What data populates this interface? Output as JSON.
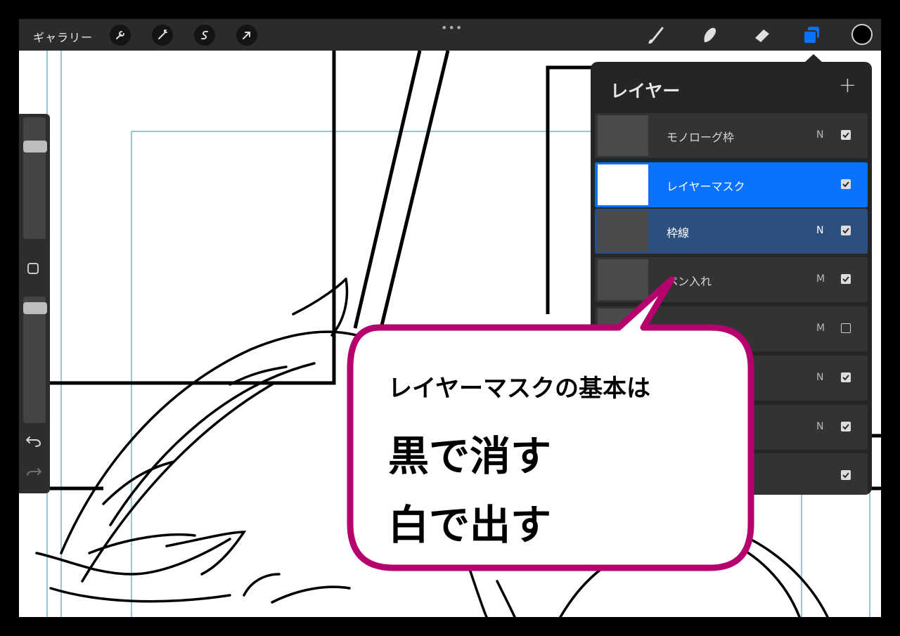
{
  "toolbar": {
    "gallery_label": "ギャラリー",
    "more_label": "•••",
    "buttons": [
      "wrench-icon",
      "magic-wand-icon",
      "selection-icon",
      "transform-arrow-icon"
    ],
    "tools": [
      "brush-icon",
      "smudge-icon",
      "eraser-icon",
      "layers-icon"
    ],
    "active_tool": "layers-icon",
    "current_color": "#000000",
    "accent_color": "#0a72ff"
  },
  "sidebar": {
    "size_slider_value": 0.85,
    "opacity_slider_value": 0.95
  },
  "layers_panel": {
    "title": "レイヤー",
    "add_label": "+",
    "layers": [
      {
        "name": "モノローグ枠",
        "mode": "N",
        "visible": true,
        "state": "normal"
      },
      {
        "name": "レイヤーマスク",
        "mode": "",
        "visible": true,
        "state": "active"
      },
      {
        "name": "枠線",
        "mode": "N",
        "visible": true,
        "state": "selected"
      },
      {
        "name": "ペン入れ",
        "mode": "M",
        "visible": true,
        "state": "normal"
      },
      {
        "name": "",
        "mode": "M",
        "visible": false,
        "state": "normal"
      },
      {
        "name": "",
        "mode": "N",
        "visible": true,
        "state": "normal"
      },
      {
        "name": "",
        "mode": "N",
        "visible": true,
        "state": "normal"
      },
      {
        "name": "",
        "mode": "",
        "visible": true,
        "state": "normal"
      }
    ]
  },
  "callout": {
    "line1": "レイヤーマスクの基本は",
    "line2": "黒で消す",
    "line3": "白で出す",
    "border_color": "#b5006e"
  }
}
